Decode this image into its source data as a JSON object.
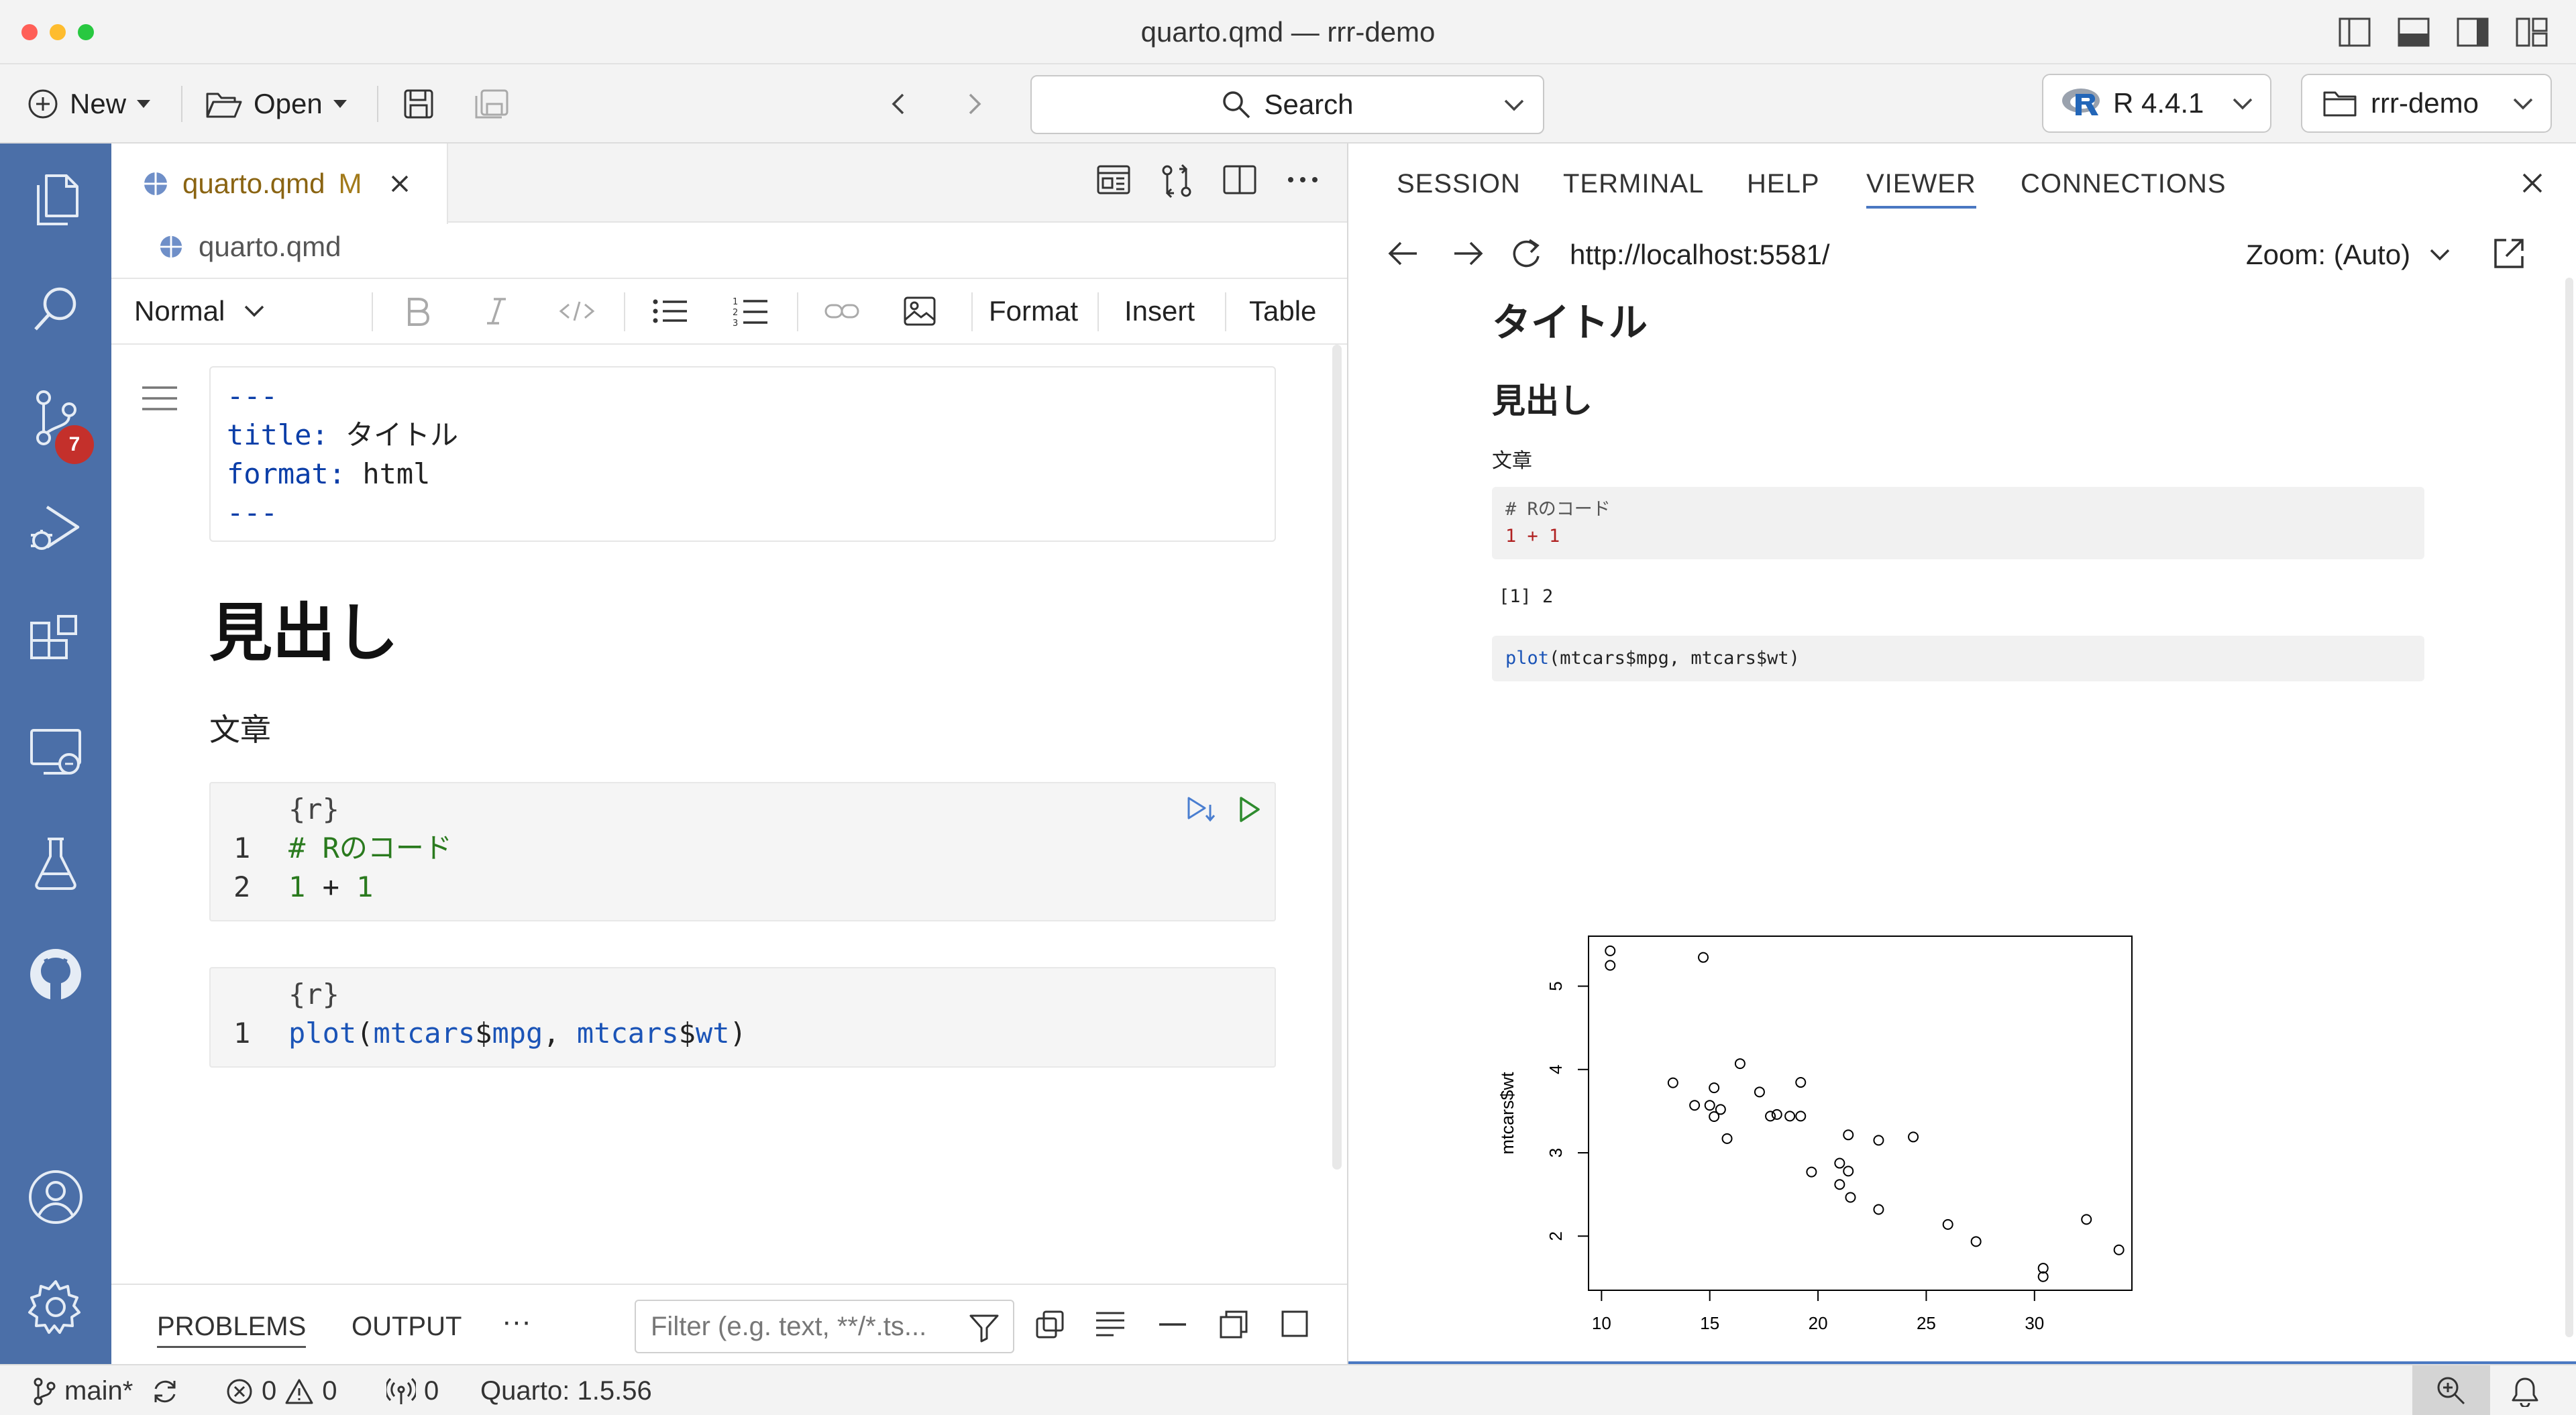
{
  "window": {
    "title": "quarto.qmd — rrr-demo"
  },
  "toolbar": {
    "new_label": "New",
    "open_label": "Open",
    "search_label": "Search",
    "r_version": "R 4.4.1",
    "project": "rrr-demo"
  },
  "activity": {
    "scm_badge": "7"
  },
  "editor": {
    "tab_label": "quarto.qmd",
    "tab_status": "M",
    "breadcrumb": "quarto.qmd",
    "format": {
      "style": "Normal",
      "format_menu": "Format",
      "insert_menu": "Insert",
      "table_menu": "Table"
    },
    "yaml": {
      "delim": "---",
      "title_key": "title:",
      "title_value": "タイトル",
      "format_key": "format:",
      "format_value": "html"
    },
    "heading": "見出し",
    "paragraph": "文章",
    "cell1": {
      "header": "{r}",
      "n1": "1",
      "line1": "# Rのコード",
      "n2": "2",
      "line2_a": "1",
      "line2_op": " + ",
      "line2_b": "1"
    },
    "cell2": {
      "header": "{r}",
      "n1": "1",
      "fn": "plot",
      "open_paren": "(",
      "arg1_obj": "mtcars",
      "dollar": "$",
      "arg1_field": "mpg",
      "comma": ", ",
      "arg2_obj": "mtcars",
      "arg2_field": "wt",
      "close_paren": ")"
    }
  },
  "panel": {
    "problems_tab": "PROBLEMS",
    "output_tab": "OUTPUT",
    "more": "···",
    "filter_placeholder": "Filter (e.g. text, **/*.ts..."
  },
  "viewer": {
    "tabs": [
      "SESSION",
      "TERMINAL",
      "HELP",
      "VIEWER",
      "CONNECTIONS"
    ],
    "url": "http://localhost:5581/",
    "zoom": "Zoom: (Auto)",
    "doc": {
      "title": "タイトル",
      "heading": "見出し",
      "paragraph": "文章",
      "code1_comment": "# Rのコード",
      "code1_line": "1 + 1",
      "output": "[1] 2",
      "code2_fn": "plot",
      "code2_args": "(mtcars$mpg, mtcars$wt)"
    }
  },
  "status": {
    "branch": "main*",
    "errors": "0",
    "warnings": "0",
    "ports": "0",
    "quarto": "Quarto: 1.5.56"
  },
  "chart_data": {
    "type": "scatter",
    "xlabel": "mtcars$mpg",
    "ylabel": "mtcars$wt",
    "xticks": [
      10,
      15,
      20,
      25,
      30
    ],
    "yticks": [
      2,
      3,
      4,
      5
    ],
    "xlim": [
      9.4,
      34.5
    ],
    "ylim": [
      1.35,
      5.6
    ],
    "points": [
      [
        21.0,
        2.62
      ],
      [
        21.0,
        2.875
      ],
      [
        22.8,
        2.32
      ],
      [
        21.4,
        3.215
      ],
      [
        18.7,
        3.44
      ],
      [
        18.1,
        3.46
      ],
      [
        14.3,
        3.57
      ],
      [
        24.4,
        3.19
      ],
      [
        22.8,
        3.15
      ],
      [
        19.2,
        3.44
      ],
      [
        17.8,
        3.44
      ],
      [
        16.4,
        4.07
      ],
      [
        17.3,
        3.73
      ],
      [
        15.2,
        3.78
      ],
      [
        10.4,
        5.25
      ],
      [
        10.4,
        5.424
      ],
      [
        14.7,
        5.345
      ],
      [
        32.4,
        2.2
      ],
      [
        30.4,
        1.615
      ],
      [
        33.9,
        1.835
      ],
      [
        21.5,
        2.465
      ],
      [
        15.5,
        3.52
      ],
      [
        15.2,
        3.435
      ],
      [
        13.3,
        3.84
      ],
      [
        19.2,
        3.845
      ],
      [
        27.3,
        1.935
      ],
      [
        26.0,
        2.14
      ],
      [
        30.4,
        1.513
      ],
      [
        15.8,
        3.17
      ],
      [
        19.7,
        2.77
      ],
      [
        15.0,
        3.57
      ],
      [
        21.4,
        2.78
      ]
    ]
  }
}
